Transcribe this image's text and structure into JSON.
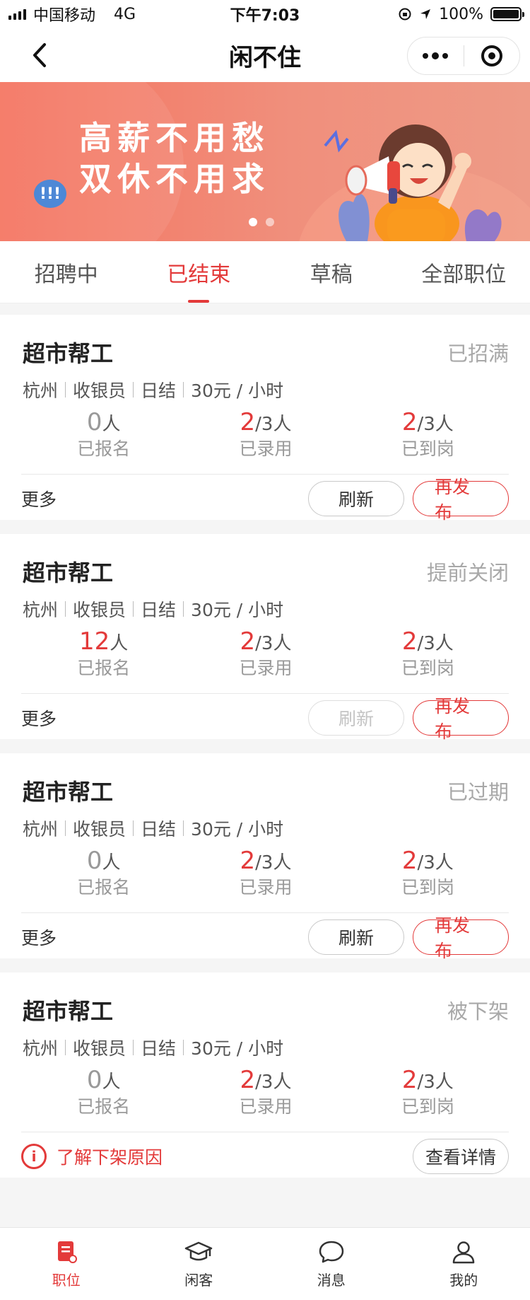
{
  "status_bar": {
    "carrier": "中国移动",
    "network": "4G",
    "time": "下午7:03",
    "battery": "100%"
  },
  "nav": {
    "title": "闲不住"
  },
  "banner": {
    "line1": "高薪不用愁",
    "line2": "双休不用求",
    "bubble": "!!!"
  },
  "tabs": [
    "招聘中",
    "已结束",
    "草稿",
    "全部职位"
  ],
  "cards": [
    {
      "title": "超市帮工",
      "status": "已招满",
      "city": "杭州",
      "role": "收银员",
      "settle": "日结",
      "pay": "30元 / 小时",
      "signed_num": "0",
      "signed_unit": "人",
      "signed_label": "已报名",
      "hired_num": "2",
      "hired_unit": "/3人",
      "hired_label": "已录用",
      "arrived_num": "2",
      "arrived_unit": "/3人",
      "arrived_label": "已到岗",
      "more": "更多",
      "refresh": "刷新",
      "republish": "再发布"
    },
    {
      "title": "超市帮工",
      "status": "提前关闭",
      "city": "杭州",
      "role": "收银员",
      "settle": "日结",
      "pay": "30元 / 小时",
      "signed_num": "12",
      "signed_unit": "人",
      "signed_label": "已报名",
      "hired_num": "2",
      "hired_unit": "/3人",
      "hired_label": "已录用",
      "arrived_num": "2",
      "arrived_unit": "/3人",
      "arrived_label": "已到岗",
      "more": "更多",
      "refresh": "刷新",
      "republish": "再发布"
    },
    {
      "title": "超市帮工",
      "status": "已过期",
      "city": "杭州",
      "role": "收银员",
      "settle": "日结",
      "pay": "30元 / 小时",
      "signed_num": "0",
      "signed_unit": "人",
      "signed_label": "已报名",
      "hired_num": "2",
      "hired_unit": "/3人",
      "hired_label": "已录用",
      "arrived_num": "2",
      "arrived_unit": "/3人",
      "arrived_label": "已到岗",
      "more": "更多",
      "refresh": "刷新",
      "republish": "再发布"
    },
    {
      "title": "超市帮工",
      "status": "被下架",
      "city": "杭州",
      "role": "收银员",
      "settle": "日结",
      "pay": "30元 / 小时",
      "signed_num": "0",
      "signed_unit": "人",
      "signed_label": "已报名",
      "hired_num": "2",
      "hired_unit": "/3人",
      "hired_label": "已录用",
      "arrived_num": "2",
      "arrived_unit": "/3人",
      "arrived_label": "已到岗",
      "reason": "了解下架原因",
      "detail": "查看详情"
    }
  ],
  "tabbar": [
    "职位",
    "闲客",
    "消息",
    "我的"
  ],
  "colors": {
    "accent": "#e33a3a",
    "muted": "#a8a8a8"
  }
}
